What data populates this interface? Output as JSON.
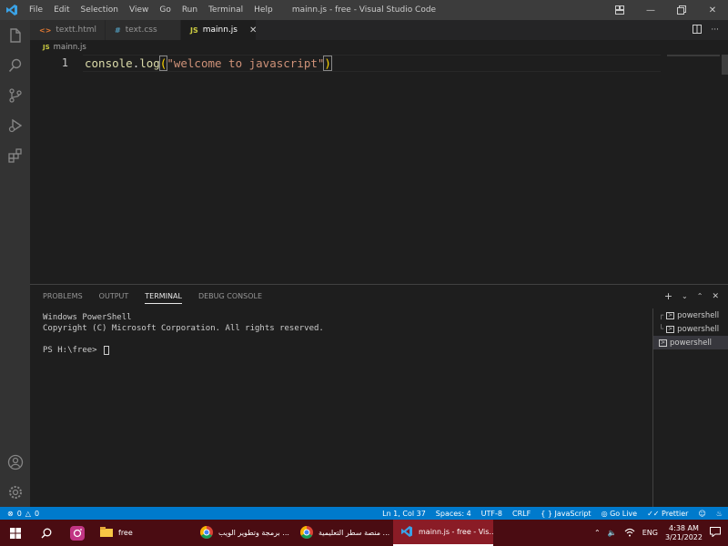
{
  "titlebar": {
    "menu": [
      "File",
      "Edit",
      "Selection",
      "View",
      "Go",
      "Run",
      "Terminal",
      "Help"
    ],
    "title": "mainn.js - free - Visual Studio Code"
  },
  "tabs": [
    {
      "icon": "<>",
      "label": "textt.html",
      "icon_color": "#e37933"
    },
    {
      "icon": "#",
      "label": "text.css",
      "icon_color": "#519aba"
    },
    {
      "icon": "JS",
      "label": "mainn.js",
      "icon_color": "#cbcb41"
    }
  ],
  "breadcrumb": {
    "icon": "JS",
    "file": "mainn.js"
  },
  "editor": {
    "line_number": "1",
    "code": {
      "obj": "console",
      "dot": ".",
      "fn": "log",
      "open": "(",
      "str": "\"welcome to javascript\"",
      "close": ")"
    }
  },
  "panel": {
    "tabs": [
      "PROBLEMS",
      "OUTPUT",
      "TERMINAL",
      "DEBUG CONSOLE"
    ],
    "terminal_lines": [
      "Windows PowerShell",
      "Copyright (C) Microsoft Corporation. All rights reserved.",
      "",
      "PS H:\\free> "
    ],
    "terminals": [
      "powershell",
      "powershell",
      "powershell"
    ]
  },
  "statusbar": {
    "errors": "0",
    "warnings": "0",
    "position": "Ln 1, Col 37",
    "spaces": "Spaces: 4",
    "encoding": "UTF-8",
    "eol": "CRLF",
    "language": "JavaScript",
    "golive": "Go Live",
    "prettier": "Prettier"
  },
  "taskbar": {
    "apps": [
      {
        "label": "free"
      },
      {
        "label": "برمجة وتطوير الويب ..."
      },
      {
        "label": "منصة سطر التعليمية ..."
      },
      {
        "label": "mainn.js - free - Vis..."
      }
    ],
    "lang": "ENG",
    "time": "4:38 AM",
    "date": "3/21/2022"
  },
  "colors": {
    "accent": "#007acc",
    "taskbar": "#4a0c12"
  }
}
